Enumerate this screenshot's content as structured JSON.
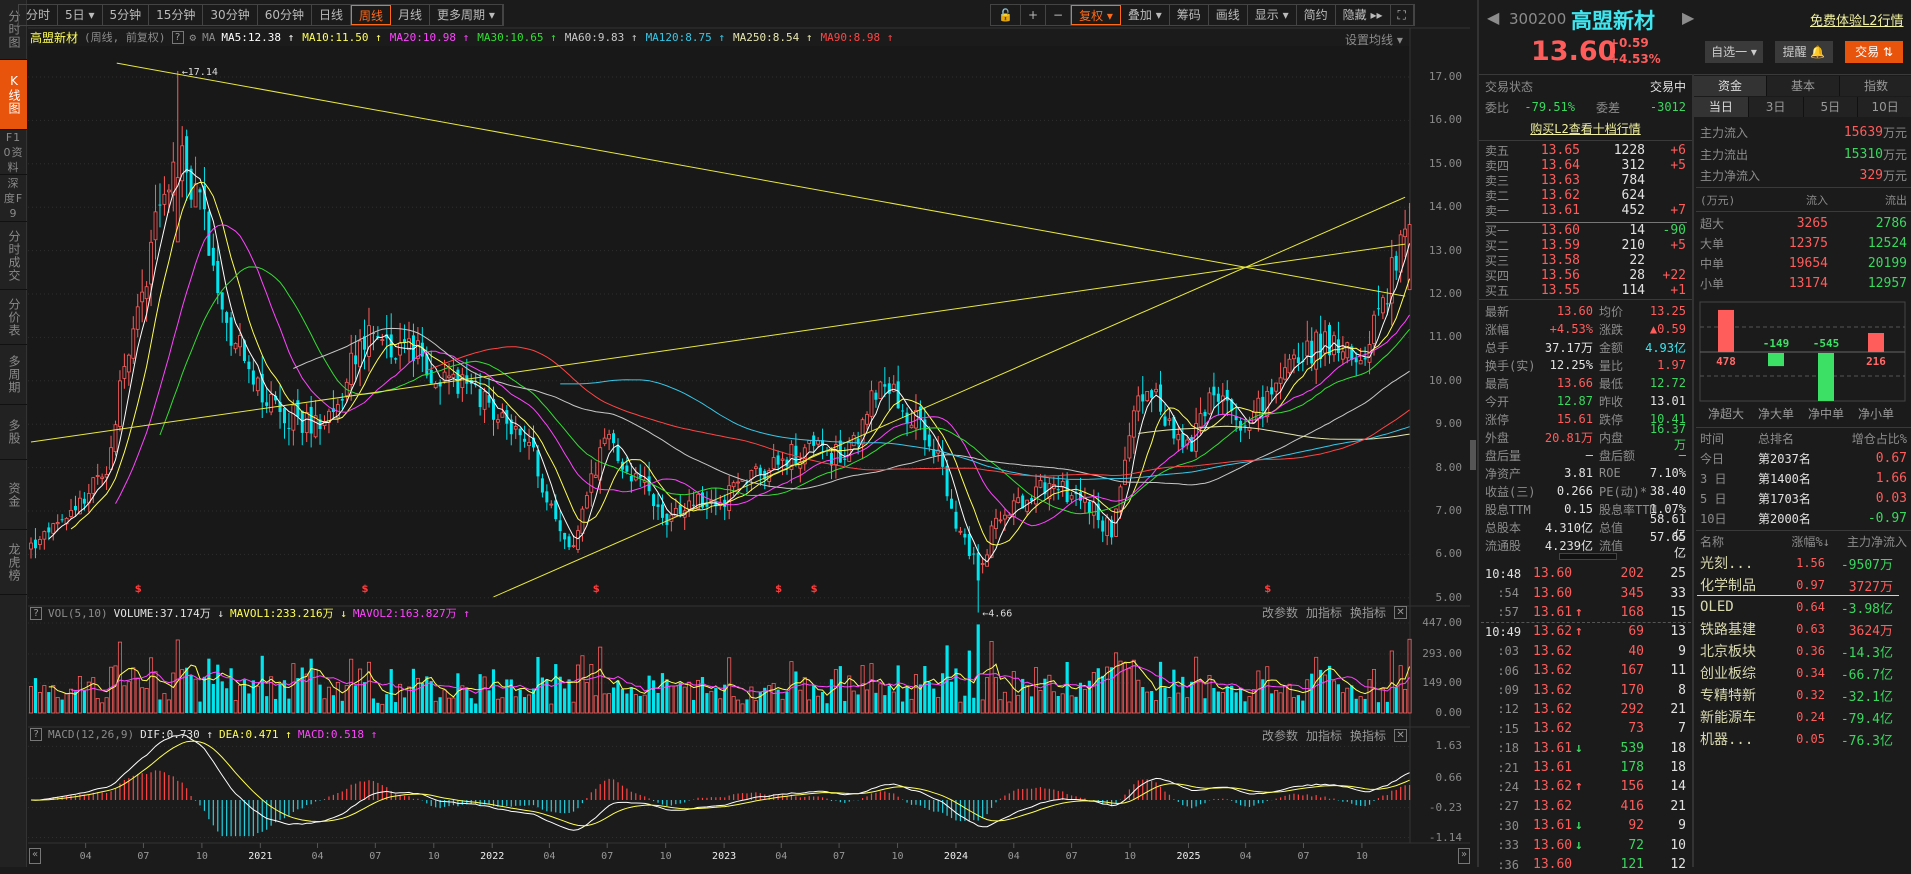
{
  "sidebar": {
    "items": [
      {
        "label": "分时图"
      },
      {
        "label": "K线图"
      },
      {
        "label": "F10资料"
      },
      {
        "label": "深度F9"
      },
      {
        "label": "分时成交"
      },
      {
        "label": "分价表"
      },
      {
        "label": "多周期"
      },
      {
        "label": "多股"
      },
      {
        "label": "资金"
      },
      {
        "label": "龙虎榜"
      }
    ]
  },
  "toolbar": {
    "periods": [
      "分时",
      "5日 ▾",
      "5分钟",
      "15分钟",
      "30分钟",
      "60分钟",
      "日线",
      "周线",
      "月线",
      "更多周期 ▾"
    ],
    "active_period": "周线",
    "right": [
      "🔓",
      "+",
      "−",
      "复权 ▾",
      "叠加 ▾",
      "筹码",
      "画线",
      "显示 ▾",
      "简约",
      "隐藏 ▸▸",
      "⛶"
    ]
  },
  "info": {
    "name": "高盟新材",
    "mode": "(周线, 前复权)",
    "help": "?",
    "ma_label": "MA",
    "ma": [
      {
        "text": "MA5:12.38 ↑",
        "color": "#ffffff"
      },
      {
        "text": "MA10:11.50 ↑",
        "color": "#ffff55"
      },
      {
        "text": "MA20:10.98 ↑",
        "color": "#ff44ff"
      },
      {
        "text": "MA30:10.65 ↑",
        "color": "#33dd33"
      },
      {
        "text": "MA60:9.83 ↑",
        "color": "#c8c8c8"
      },
      {
        "text": "MA120:8.75 ↑",
        "color": "#36c8e8"
      },
      {
        "text": "MA250:8.54 ↑",
        "color": "#e6e6b0"
      },
      {
        "text": "MA90:8.98 ↑",
        "color": "#ff4444"
      }
    ],
    "set_ma": "设置均线 ▾"
  },
  "pane_tools": {
    "params": "改参数",
    "add": "加指标",
    "switch": "换指标",
    "close": "✕"
  },
  "vol_head": {
    "help": "?",
    "name": "VOL(5,10)",
    "volume": "VOLUME:37.174万 ↓",
    "mavol1": "MAVOL1:233.216万 ↓",
    "mavol2": "MAVOL2:163.827万 ↑"
  },
  "macd_head": {
    "help": "?",
    "name": "MACD(12,26,9)",
    "dif": "DIF:0.730 ↑",
    "dea": "DEA:0.471 ↑",
    "macd": "MACD:0.518 ↑"
  },
  "scroll": {
    "left": "«",
    "right": "»"
  },
  "chart_data": {
    "type": "candlestick",
    "title": "高盟新材 周线 前复权",
    "price_axis": {
      "ticks": [
        "17.00",
        "16.00",
        "15.00",
        "14.00",
        "13.00",
        "12.00",
        "11.00",
        "10.00",
        "9.00",
        "8.00",
        "7.00",
        "6.00",
        "5.00"
      ],
      "ylim": [
        5,
        17
      ]
    },
    "volume_axis": {
      "ticks": [
        "447.00",
        "293.00",
        "149.00",
        "0.00"
      ],
      "ylim": [
        0,
        447
      ],
      "unit": "万"
    },
    "macd_axis": {
      "ticks": [
        "1.63",
        "0.66",
        "-0.23",
        "-1.14"
      ],
      "ylim": [
        -1.14,
        1.63
      ]
    },
    "x_ticks": [
      {
        "label": "04",
        "date": "2020-04-01"
      },
      {
        "label": "07",
        "date": "2020-07-01"
      },
      {
        "label": "10",
        "date": "2020-10-01"
      },
      {
        "label": "2021",
        "date": "2021-01-01",
        "year": true
      },
      {
        "label": "04",
        "date": "2021-04-01"
      },
      {
        "label": "07",
        "date": "2021-07-01"
      },
      {
        "label": "10",
        "date": "2021-10-01"
      },
      {
        "label": "2022",
        "date": "2022-01-01",
        "year": true
      },
      {
        "label": "04",
        "date": "2022-04-01"
      },
      {
        "label": "07",
        "date": "2022-07-01"
      },
      {
        "label": "10",
        "date": "2022-10-01"
      },
      {
        "label": "2023",
        "date": "2023-01-01",
        "year": true
      },
      {
        "label": "04",
        "date": "2023-04-01"
      },
      {
        "label": "07",
        "date": "2023-07-01"
      },
      {
        "label": "10",
        "date": "2023-10-01"
      },
      {
        "label": "2024",
        "date": "2024-01-01",
        "year": true
      },
      {
        "label": "04",
        "date": "2024-04-01"
      },
      {
        "label": "07",
        "date": "2024-07-01"
      },
      {
        "label": "10",
        "date": "2024-10-01"
      },
      {
        "label": "2025",
        "date": "2025-01-01",
        "year": true
      },
      {
        "label": "04",
        "date": "2025-04-01"
      },
      {
        "label": "07",
        "date": "2025-07-01"
      },
      {
        "label": "10",
        "date": "2025-10-01"
      }
    ],
    "close_anchors": [
      [
        "2020-01-06",
        6.2
      ],
      [
        "2020-03-02",
        6.8
      ],
      [
        "2020-05-04",
        8.0
      ],
      [
        "2020-06-01",
        10.5
      ],
      [
        "2020-07-06",
        12.5
      ],
      [
        "2020-08-03",
        14.5
      ],
      [
        "2020-09-07",
        15.0
      ],
      [
        "2020-10-05",
        13.5
      ],
      [
        "2020-11-02",
        11.5
      ],
      [
        "2020-12-07",
        10.5
      ],
      [
        "2021-01-04",
        9.8
      ],
      [
        "2021-02-01",
        9.2
      ],
      [
        "2021-04-05",
        9.0
      ],
      [
        "2021-05-03",
        9.5
      ],
      [
        "2021-06-07",
        10.8
      ],
      [
        "2021-07-05",
        11.2
      ],
      [
        "2021-08-02",
        10.5
      ],
      [
        "2021-09-06",
        10.8
      ],
      [
        "2021-10-04",
        10.0
      ],
      [
        "2021-12-06",
        9.8
      ],
      [
        "2022-01-03",
        9.3
      ],
      [
        "2022-03-07",
        8.3
      ],
      [
        "2022-04-04",
        7.0
      ],
      [
        "2022-05-02",
        6.0
      ],
      [
        "2022-06-06",
        7.8
      ],
      [
        "2022-07-04",
        8.6
      ],
      [
        "2022-08-01",
        8.0
      ],
      [
        "2022-10-03",
        6.8
      ],
      [
        "2022-11-07",
        7.2
      ],
      [
        "2023-01-02",
        7.3
      ],
      [
        "2023-03-06",
        8.0
      ],
      [
        "2023-05-01",
        8.4
      ],
      [
        "2023-07-03",
        8.3
      ],
      [
        "2023-08-07",
        8.8
      ],
      [
        "2023-09-04",
        10.2
      ],
      [
        "2023-10-02",
        9.6
      ],
      [
        "2023-11-06",
        8.9
      ],
      [
        "2023-12-04",
        8.3
      ],
      [
        "2024-01-01",
        6.8
      ],
      [
        "2024-02-05",
        5.6
      ],
      [
        "2024-03-04",
        6.8
      ],
      [
        "2024-05-06",
        7.5
      ],
      [
        "2024-06-03",
        7.6
      ],
      [
        "2024-08-05",
        7.0
      ],
      [
        "2024-09-02",
        6.5
      ],
      [
        "2024-10-07",
        9.3
      ],
      [
        "2024-11-04",
        9.8
      ],
      [
        "2024-12-02",
        9.0
      ],
      [
        "2025-01-06",
        8.6
      ],
      [
        "2025-02-03",
        9.5
      ],
      [
        "2025-03-03",
        9.3
      ],
      [
        "2025-04-07",
        8.8
      ],
      [
        "2025-05-05",
        9.8
      ],
      [
        "2025-06-02",
        10.2
      ],
      [
        "2025-07-07",
        10.6
      ],
      [
        "2025-08-04",
        10.9
      ],
      [
        "2025-09-01",
        10.5
      ],
      [
        "2025-10-06",
        10.8
      ],
      [
        "2025-11-03",
        11.8
      ],
      [
        "2025-12-08",
        13.6
      ]
    ],
    "extremes": [
      {
        "date": "2020-08-24",
        "high": 17.14,
        "label": "17.14"
      },
      {
        "date": "2024-02-05",
        "low": 4.66,
        "label": "4.66"
      }
    ],
    "last": {
      "close": 13.6,
      "high": 13.66,
      "low": 12.72
    },
    "trendlines": [
      [
        [
          "2020-05-20",
          17.32
        ],
        [
          "2025-12-08",
          11.95
        ]
      ],
      [
        [
          "2022-01-03",
          5.02
        ],
        [
          "2025-12-08",
          14.23
        ]
      ],
      [
        [
          "2020-01-06",
          8.59
        ],
        [
          "2025-12-08",
          13.15
        ]
      ]
    ],
    "ma_periods": [
      5,
      10,
      20,
      30,
      60,
      120,
      250,
      90
    ],
    "ma_colors": [
      "#ffffff",
      "#ffff55",
      "#ff44ff",
      "#33dd33",
      "#c8c8c8",
      "#36c8e8",
      "#e6e6b0",
      "#ff4444"
    ],
    "event_markers": {
      "label": "$",
      "dates": [
        "2020-06-22",
        "2021-06-14",
        "2022-06-13",
        "2023-03-27",
        "2023-05-22",
        "2025-05-05"
      ]
    },
    "colors": {
      "up": "#ff5c5c",
      "down": "#00e5ee",
      "trend": "#e8e840"
    }
  },
  "quote": {
    "code": "300200",
    "name": "高盟新材",
    "l2_link": "免费体验L2行情",
    "price": "13.60",
    "change": "+0.59",
    "change_pct": "+4.53%",
    "watch_btn": "自选一 ▾",
    "alert_btn": "提醒 🔔",
    "trade_btn": "交易 ⇅",
    "status_label": "交易状态",
    "status": "交易中",
    "weibi_label": "委比",
    "weibi": "-79.51%",
    "weicha_label": "委差",
    "weicha": "-3012",
    "buy_l2": "购买L2查看十档行情"
  },
  "orderbook": {
    "sell": [
      {
        "label": "卖五",
        "price": "13.65",
        "vol": "1228",
        "chg": "+6",
        "cc": "r"
      },
      {
        "label": "卖四",
        "price": "13.64",
        "vol": "312",
        "chg": "+5",
        "cc": "r"
      },
      {
        "label": "卖三",
        "price": "13.63",
        "vol": "784",
        "chg": "",
        "cc": "r"
      },
      {
        "label": "卖二",
        "price": "13.62",
        "vol": "624",
        "chg": "",
        "cc": "r"
      },
      {
        "label": "卖一",
        "price": "13.61",
        "vol": "452",
        "chg": "+7",
        "cc": "r"
      }
    ],
    "buy": [
      {
        "label": "买一",
        "price": "13.60",
        "vol": "14",
        "chg": "-90",
        "cc": "g"
      },
      {
        "label": "买二",
        "price": "13.59",
        "vol": "210",
        "chg": "+5",
        "cc": "r"
      },
      {
        "label": "买三",
        "price": "13.58",
        "vol": "22",
        "chg": "",
        "cc": "r"
      },
      {
        "label": "买四",
        "price": "13.56",
        "vol": "28",
        "chg": "+22",
        "cc": "r"
      },
      {
        "label": "买五",
        "price": "13.55",
        "vol": "114",
        "chg": "+1",
        "cc": "r"
      }
    ]
  },
  "stats": [
    {
      "l1": "最新",
      "v1": "13.60",
      "c1": "r",
      "l2": "均价",
      "v2": "13.25",
      "c2": "r"
    },
    {
      "l1": "涨幅",
      "v1": "+4.53%",
      "c1": "r",
      "l2": "涨跌",
      "v2": "▲0.59",
      "c2": "r"
    },
    {
      "l1": "总手",
      "v1": "37.17万",
      "c1": "w",
      "l2": "金额",
      "v2": "4.93亿",
      "c2": "c"
    },
    {
      "l1": "换手(实)",
      "v1": "12.25%",
      "c1": "w",
      "l2": "量比",
      "v2": "1.97",
      "c2": "r"
    },
    {
      "l1": "最高",
      "v1": "13.66",
      "c1": "r",
      "l2": "最低",
      "v2": "12.72",
      "c2": "g"
    },
    {
      "l1": "今开",
      "v1": "12.87",
      "c1": "g",
      "l2": "昨收",
      "v2": "13.01",
      "c2": "w"
    },
    {
      "l1": "涨停",
      "v1": "15.61",
      "c1": "r",
      "l2": "跌停",
      "v2": "10.41",
      "c2": "g"
    },
    {
      "l1": "外盘",
      "v1": "20.81万",
      "c1": "r",
      "l2": "内盘",
      "v2": "16.37万",
      "c2": "g"
    },
    {
      "l1": "盘后量",
      "v1": "—",
      "c1": "w",
      "l2": "盘后额",
      "v2": "—",
      "c2": "c"
    },
    {
      "l1": "净资产",
      "v1": "3.81",
      "c1": "w",
      "l2": "ROE",
      "v2": "7.10%",
      "c2": "w"
    },
    {
      "l1": "收益(三)",
      "v1": "0.266",
      "c1": "w",
      "l2": "PE(动)*",
      "v2": "38.40",
      "c2": "w"
    },
    {
      "l1": "股息TTM",
      "v1": "0.15",
      "c1": "w",
      "l2": "股息率TTM",
      "v2": "1.07%",
      "c2": "w"
    },
    {
      "l1": "总股本",
      "v1": "4.310亿",
      "c1": "w",
      "l2": "总值",
      "v2": "58.61亿",
      "c2": "w"
    },
    {
      "l1": "流通股",
      "v1": "4.239亿",
      "c1": "w",
      "l2": "流值",
      "v2": "57.65亿",
      "c2": "w"
    }
  ],
  "ticks": [
    {
      "t": "10:48",
      "p": "13.60",
      "a": "",
      "ac": "r",
      "v": "202",
      "vc": "r",
      "n": "25",
      "tc": "w"
    },
    {
      "t": ":54",
      "p": "13.60",
      "a": "",
      "ac": "r",
      "v": "345",
      "vc": "r",
      "n": "33",
      "tc": "gy"
    },
    {
      "t": ":57",
      "p": "13.61",
      "a": "↑",
      "ac": "r",
      "v": "168",
      "vc": "r",
      "n": "15",
      "tc": "gy"
    },
    {
      "t": "10:49",
      "p": "13.62",
      "a": "↑",
      "ac": "r",
      "v": "69",
      "vc": "r",
      "n": "13",
      "tc": "w"
    },
    {
      "t": ":03",
      "p": "13.62",
      "a": "",
      "ac": "r",
      "v": "40",
      "vc": "r",
      "n": "9",
      "tc": "gy"
    },
    {
      "t": ":06",
      "p": "13.62",
      "a": "",
      "ac": "r",
      "v": "167",
      "vc": "r",
      "n": "11",
      "tc": "gy"
    },
    {
      "t": ":09",
      "p": "13.62",
      "a": "",
      "ac": "r",
      "v": "170",
      "vc": "r",
      "n": "8",
      "tc": "gy"
    },
    {
      "t": ":12",
      "p": "13.62",
      "a": "",
      "ac": "r",
      "v": "292",
      "vc": "r",
      "n": "21",
      "tc": "gy"
    },
    {
      "t": ":15",
      "p": "13.62",
      "a": "",
      "ac": "r",
      "v": "73",
      "vc": "r",
      "n": "7",
      "tc": "gy"
    },
    {
      "t": ":18",
      "p": "13.61",
      "a": "↓",
      "ac": "g",
      "v": "539",
      "vc": "g",
      "n": "18",
      "tc": "gy"
    },
    {
      "t": ":21",
      "p": "13.61",
      "a": "",
      "ac": "r",
      "v": "178",
      "vc": "g",
      "n": "18",
      "tc": "gy"
    },
    {
      "t": ":24",
      "p": "13.62",
      "a": "↑",
      "ac": "r",
      "v": "156",
      "vc": "r",
      "n": "14",
      "tc": "gy"
    },
    {
      "t": ":27",
      "p": "13.62",
      "a": "",
      "ac": "r",
      "v": "416",
      "vc": "r",
      "n": "21",
      "tc": "gy"
    },
    {
      "t": ":30",
      "p": "13.61",
      "a": "↓",
      "ac": "g",
      "v": "92",
      "vc": "r",
      "n": "9",
      "tc": "gy"
    },
    {
      "t": ":33",
      "p": "13.60",
      "a": "↓",
      "ac": "g",
      "v": "72",
      "vc": "g",
      "n": "10",
      "tc": "gy"
    },
    {
      "t": ":36",
      "p": "13.60",
      "a": "",
      "ac": "r",
      "v": "121",
      "vc": "g",
      "n": "12",
      "tc": "gy"
    }
  ],
  "funds": {
    "tabs": [
      "资金",
      "基本",
      "指数"
    ],
    "periods": [
      "当日",
      "3日",
      "5日",
      "10日"
    ],
    "main": [
      {
        "label": "主力流入",
        "value": "15639",
        "cc": "r",
        "unit": "万元"
      },
      {
        "label": "主力流出",
        "value": "15310",
        "cc": "g",
        "unit": "万元"
      },
      {
        "label": "主力净流入",
        "value": "329",
        "cc": "r",
        "unit": "万元"
      }
    ],
    "head": {
      "unit": "(万元)",
      "in": "流入",
      "out": "流出"
    },
    "rows": [
      {
        "label": "超大",
        "in": "3265",
        "out": "2786"
      },
      {
        "label": "大单",
        "in": "12375",
        "out": "12524"
      },
      {
        "label": "中单",
        "in": "19654",
        "out": "20199"
      },
      {
        "label": "小单",
        "in": "13174",
        "out": "12957"
      }
    ],
    "net": [
      {
        "label": "净超大",
        "value": 478,
        "text": "478"
      },
      {
        "label": "净大单",
        "value": -149,
        "text": "-149"
      },
      {
        "label": "净中单",
        "value": -545,
        "text": "-545"
      },
      {
        "label": "净小单",
        "value": 216,
        "text": "216"
      }
    ]
  },
  "rank": {
    "head": {
      "time": "时间",
      "rank": "总排名",
      "ratio": "增仓占比%"
    },
    "rows": [
      {
        "t": "今日",
        "r": "第2037名",
        "v": "0.67",
        "cc": "r"
      },
      {
        "t": "3 日",
        "r": "第1400名",
        "v": "1.66",
        "cc": "r"
      },
      {
        "t": "5 日",
        "r": "第1703名",
        "v": "0.03",
        "cc": "r"
      },
      {
        "t": "10日",
        "r": "第2000名",
        "v": "-0.97",
        "cc": "g"
      }
    ]
  },
  "sectors": {
    "head": {
      "name": "名称",
      "pct": "涨幅%↓",
      "flow": "主力净流入"
    },
    "rows": [
      {
        "n": "光刻...",
        "p": "1.56",
        "f": "-9507万",
        "cc": "g"
      },
      {
        "n": "化学制品",
        "p": "0.97",
        "f": "3727万",
        "cc": "r"
      },
      {
        "n": "OLED",
        "p": "0.64",
        "f": "-3.98亿",
        "cc": "g"
      },
      {
        "n": "铁路基建",
        "p": "0.63",
        "f": "3624万",
        "cc": "r"
      },
      {
        "n": "北京板块",
        "p": "0.36",
        "f": "-14.3亿",
        "cc": "g"
      },
      {
        "n": "创业板综",
        "p": "0.34",
        "f": "-66.7亿",
        "cc": "g"
      },
      {
        "n": "专精特新",
        "p": "0.32",
        "f": "-32.1亿",
        "cc": "g"
      },
      {
        "n": "新能源车",
        "p": "0.24",
        "f": "-79.4亿",
        "cc": "g"
      },
      {
        "n": "机器...",
        "p": "0.05",
        "f": "-76.3亿",
        "cc": "g"
      }
    ]
  }
}
